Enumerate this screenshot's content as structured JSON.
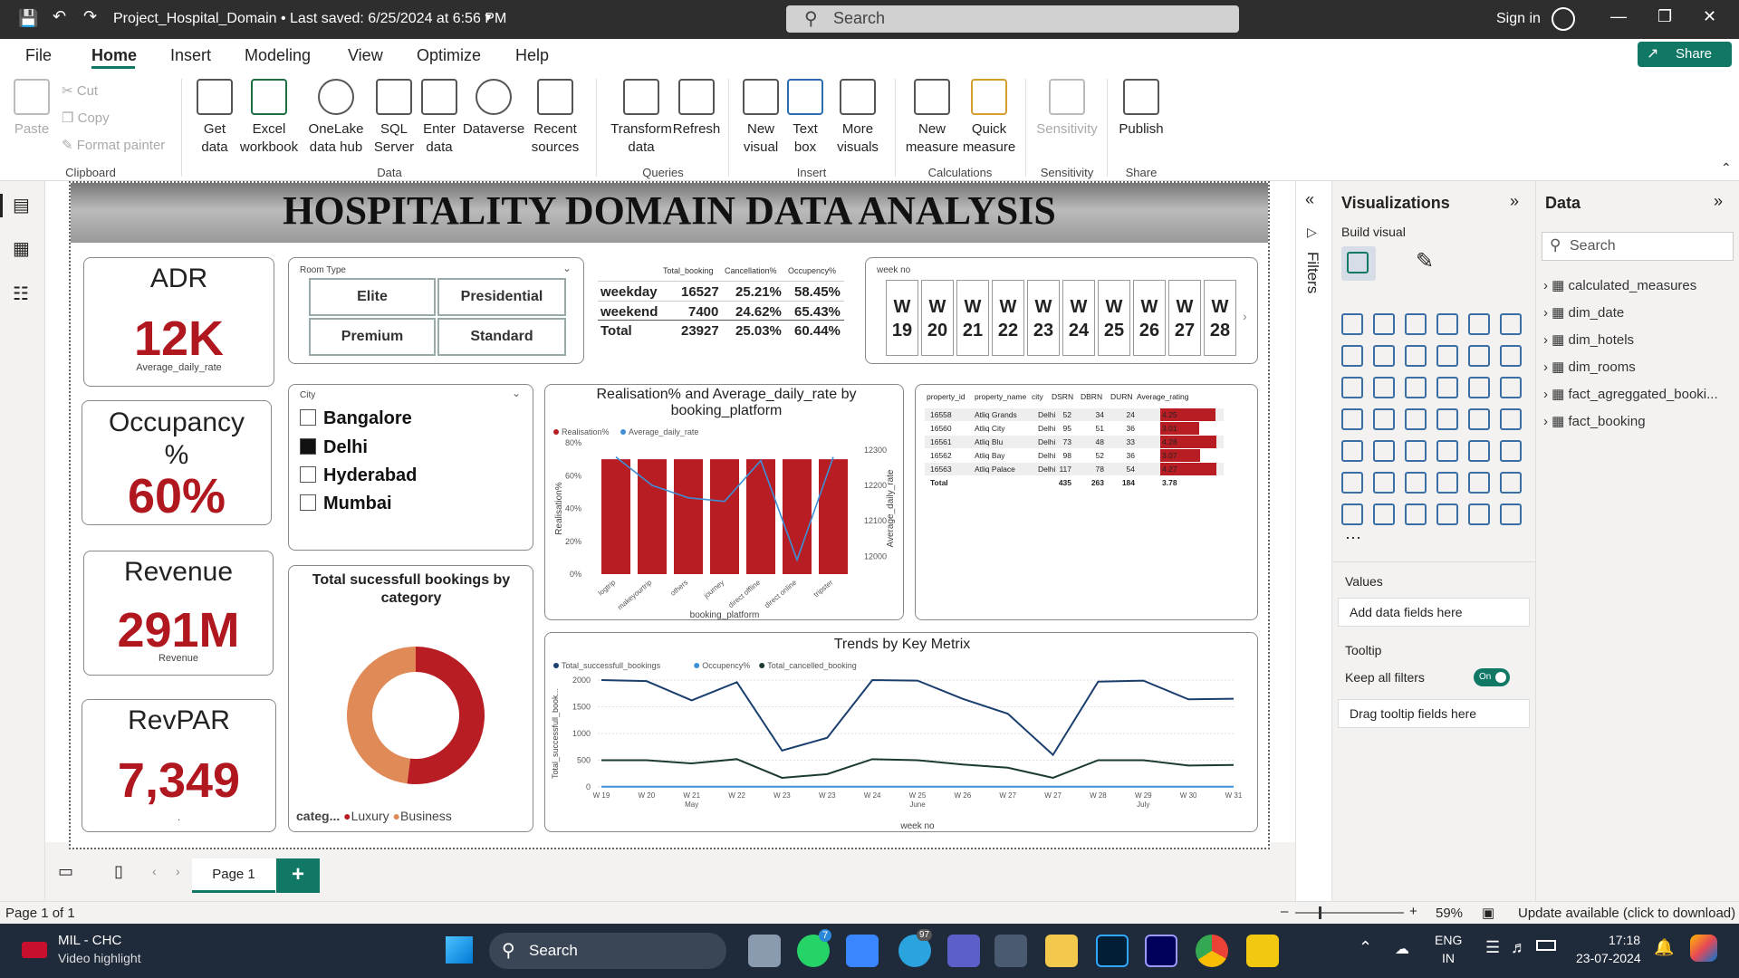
{
  "titlebar": {
    "title": "Project_Hospital_Domain • Last saved: 6/25/2024 at 6:56 PM",
    "search_placeholder": "Search",
    "signin": "Sign in"
  },
  "menu": {
    "file": "File",
    "home": "Home",
    "insert": "Insert",
    "modeling": "Modeling",
    "view": "View",
    "optimize": "Optimize",
    "help": "Help",
    "share": "Share"
  },
  "ribbon": {
    "paste": "Paste",
    "cut": "Cut",
    "copy": "Copy",
    "format_painter": "Format painter",
    "clipboard": "Clipboard",
    "get_data": "Get\ndata",
    "excel": "Excel\nworkbook",
    "onelake": "OneLake\ndata hub",
    "sql": "SQL\nServer",
    "enter": "Enter\ndata",
    "dataverse": "Dataverse",
    "recent": "Recent\nsources",
    "data_group": "Data",
    "transform": "Transform\ndata",
    "refresh": "Refresh",
    "queries": "Queries",
    "new_visual": "New\nvisual",
    "text_box": "Text\nbox",
    "more_visuals": "More\nvisuals",
    "insert_group": "Insert",
    "new_measure": "New\nmeasure",
    "quick_measure": "Quick\nmeasure",
    "calculations": "Calculations",
    "sensitivity": "Sensitivity",
    "sensitivity_group": "Sensitivity",
    "publish": "Publish",
    "share_group": "Share"
  },
  "report": {
    "banner": "HOSPITALITY DOMAIN  DATA ANALYSIS",
    "kpis": [
      {
        "title": "ADR",
        "value": "12K",
        "sub": "Average_daily_rate"
      },
      {
        "title": "Occupancy\n%",
        "value": "60%",
        "sub": ""
      },
      {
        "title": "Revenue",
        "value": "291M",
        "sub": "Revenue"
      },
      {
        "title": "RevPAR",
        "value": "7,349",
        "sub": "."
      }
    ],
    "room_type": {
      "label": "Room Type",
      "options": [
        "Elite",
        "Presidential",
        "Premium",
        "Standard"
      ]
    },
    "city": {
      "label": "City",
      "options": [
        {
          "name": "Bangalore",
          "checked": false
        },
        {
          "name": "Delhi",
          "checked": true
        },
        {
          "name": "Hyderabad",
          "checked": false
        },
        {
          "name": "Mumbai",
          "checked": false
        }
      ]
    },
    "daytype_table": {
      "headers": [
        "",
        "Total_booking",
        "Cancellation%",
        "Occupency%"
      ],
      "rows": [
        [
          "weekday",
          "16527",
          "25.21%",
          "58.45%"
        ],
        [
          "weekend",
          "7400",
          "24.62%",
          "65.43%"
        ],
        [
          "Total",
          "23927",
          "25.03%",
          "60.44%"
        ]
      ]
    },
    "week_slicer": {
      "label": "week no",
      "weeks": [
        "W 19",
        "W 20",
        "W 21",
        "W 22",
        "W 23",
        "W 24",
        "W 25",
        "W 26",
        "W 27",
        "W 28"
      ]
    },
    "property_table": {
      "headers": [
        "property_id",
        "property_name",
        "city",
        "DSRN",
        "DBRN",
        "DURN",
        "Average_rating"
      ],
      "rows": [
        [
          "16558",
          "Atliq Grands",
          "Delhi",
          "52",
          "34",
          "24",
          "4.25"
        ],
        [
          "16560",
          "Atliq City",
          "Delhi",
          "95",
          "51",
          "36",
          "3.01"
        ],
        [
          "16561",
          "Atliq Blu",
          "Delhi",
          "73",
          "48",
          "33",
          "4.28"
        ],
        [
          "16562",
          "Atliq Bay",
          "Delhi",
          "98",
          "52",
          "36",
          "3.07"
        ],
        [
          "16563",
          "Atliq Palace",
          "Delhi",
          "117",
          "78",
          "54",
          "4.27"
        ]
      ],
      "total": [
        "Total",
        "",
        "",
        "435",
        "263",
        "184",
        "3.78"
      ]
    }
  },
  "chart_data": [
    {
      "type": "bar",
      "title": "Realisation% and Average_daily_rate by booking_platform",
      "xlabel": "booking_platform",
      "ylabel": "Realisation%",
      "y2label": "Average_daily_rate",
      "legend": [
        "Realisation%",
        "Average_daily_rate"
      ],
      "categories": [
        "logtrip",
        "makeyourtrip",
        "others",
        "journey",
        "direct offline",
        "direct online",
        "tripster"
      ],
      "series": [
        {
          "name": "Realisation%",
          "values": [
            70,
            70,
            70,
            70,
            70,
            70,
            70
          ]
        },
        {
          "name": "Average_daily_rate",
          "values": [
            12280,
            12200,
            12165,
            12155,
            12270,
            11990,
            12280
          ]
        }
      ],
      "ylim": [
        0,
        80
      ],
      "y2lim": [
        12000,
        12300
      ],
      "yticks": [
        "0%",
        "20%",
        "40%",
        "60%",
        "80%"
      ],
      "y2ticks": [
        "12000",
        "12100",
        "12200",
        "12300"
      ],
      "color": "#b81d24"
    },
    {
      "type": "pie",
      "title": "Total sucessfull bookings by category",
      "legend_title": "categ...",
      "legend": [
        "Luxury",
        "Business"
      ],
      "series": [
        {
          "name": "Luxury",
          "value": 52,
          "color": "#b81d24"
        },
        {
          "name": "Business",
          "value": 48,
          "color": "#e08a57"
        }
      ]
    },
    {
      "type": "line",
      "title": "Trends by Key Metrix",
      "xlabel": "week no",
      "ylabel": "Total_successfull_book...",
      "legend": [
        "Total_successfull_bookings",
        "Occupency%",
        "Total_cancelled_booking"
      ],
      "categories": [
        "W 19",
        "W 20",
        "W 21",
        "W 22",
        "W 23",
        "W 23",
        "W 24",
        "W 25",
        "W 26",
        "W 27",
        "W 27",
        "W 28",
        "W 29",
        "W 30",
        "W 31"
      ],
      "month_labels": [
        {
          "label": "May",
          "index": 2
        },
        {
          "label": "June",
          "index": 7
        },
        {
          "label": "July",
          "index": 12
        }
      ],
      "yticks": [
        "0",
        "500",
        "1000",
        "1500",
        "2000"
      ],
      "ylim": [
        0,
        2000
      ],
      "series": [
        {
          "name": "Total_successfull_bookings",
          "color": "#1a3e6e",
          "values": [
            2000,
            1980,
            1620,
            1960,
            680,
            920,
            2000,
            1990,
            1650,
            1370,
            600,
            1970,
            1990,
            1640,
            1650
          ]
        },
        {
          "name": "Occupency%",
          "color": "#3d8fd6",
          "values": [
            5,
            5,
            5,
            5,
            5,
            5,
            5,
            5,
            5,
            5,
            5,
            5,
            5,
            5,
            5
          ]
        },
        {
          "name": "Total_cancelled_booking",
          "color": "#1b3a34",
          "values": [
            500,
            500,
            440,
            520,
            170,
            240,
            520,
            500,
            420,
            360,
            170,
            500,
            500,
            400,
            410
          ]
        }
      ]
    }
  ],
  "filters_label": "Filters",
  "visualizations": {
    "title": "Visualizations",
    "build": "Build visual",
    "values": "Values",
    "values_placeholder": "Add data fields here",
    "tooltip": "Tooltip",
    "keep_filters": "Keep all filters",
    "toggle": "On",
    "tooltip_placeholder": "Drag tooltip fields here"
  },
  "data_pane": {
    "title": "Data",
    "search": "Search",
    "fields": [
      "calculated_measures",
      "dim_date",
      "dim_hotels",
      "dim_rooms",
      "fact_agreggated_booki...",
      "fact_booking"
    ]
  },
  "pages": {
    "tab": "Page 1",
    "add": "+"
  },
  "status": {
    "page": "Page 1 of 1",
    "zoom": "59%",
    "update": "Update available (click to download)"
  },
  "taskbar": {
    "news_title": "MIL - CHC",
    "news_sub": "Video highlight",
    "search": "Search",
    "lang": "ENG",
    "region": "IN",
    "time": "17:18",
    "date": "23-07-2024",
    "badge1": "7",
    "badge2": "97"
  }
}
